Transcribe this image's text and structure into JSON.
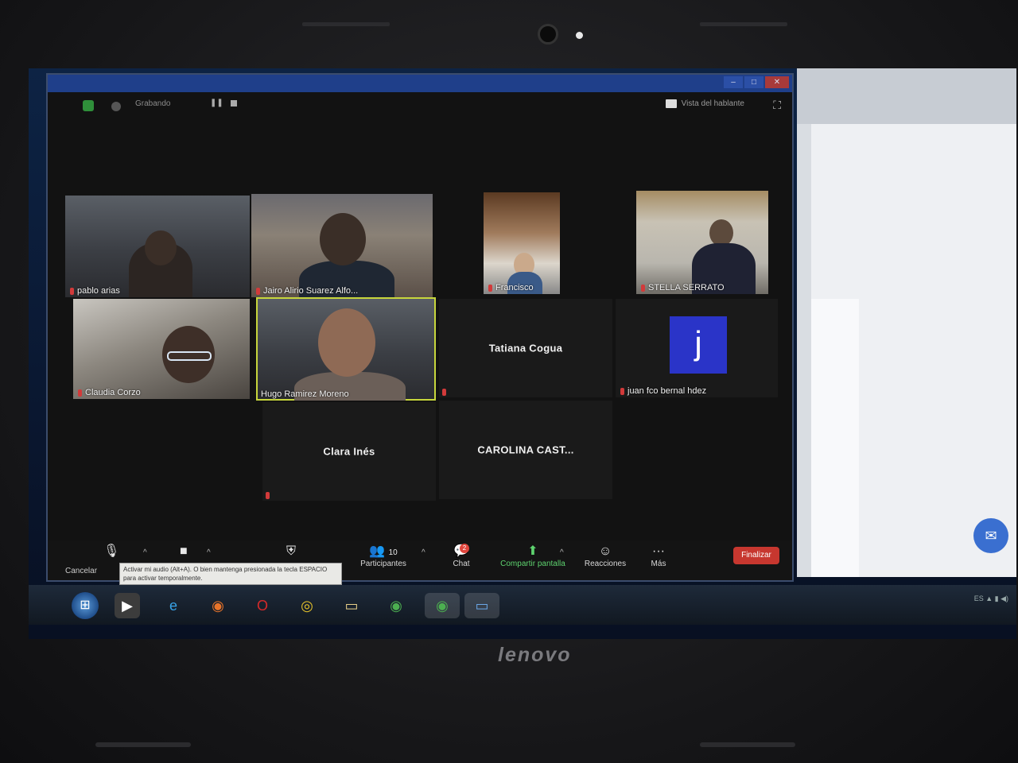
{
  "brand": {
    "laptop": "lenovo"
  },
  "zoom": {
    "top_bar": {
      "recording": "Grabando",
      "view_button": "Vista del hablante"
    },
    "participants": [
      {
        "id": "pablo",
        "name": "pablo arias",
        "muted": true,
        "video": true
      },
      {
        "id": "jairo",
        "name": "Jairo Alirio Suarez Alfo...",
        "muted": true,
        "video": true
      },
      {
        "id": "francisco",
        "name": "Francisco",
        "muted": true,
        "video": true
      },
      {
        "id": "stella",
        "name": "STELLA SERRATO",
        "muted": true,
        "video": true
      },
      {
        "id": "claudia",
        "name": "Claudia Corzo",
        "muted": true,
        "video": true
      },
      {
        "id": "hugo",
        "name": "Hugo Ramirez Moreno",
        "muted": false,
        "video": true,
        "active_speaker": true
      },
      {
        "id": "tatiana",
        "name": "Tatiana Cogua",
        "muted": true,
        "video": false
      },
      {
        "id": "juan",
        "name": "juan fco bernal hdez",
        "muted": true,
        "video": false,
        "avatar_letter": "j"
      },
      {
        "id": "clara",
        "name": "Clara Inés",
        "muted": true,
        "video": false
      },
      {
        "id": "carolina",
        "name": "CAROLINA CAST...",
        "muted": false,
        "video": false
      }
    ],
    "toolbar": {
      "cancel": "Cancelar",
      "participants_label": "Participantes",
      "participants_count": "10",
      "chat_label": "Chat",
      "chat_badge": "2",
      "share_label": "Compartir pantalla",
      "reactions_label": "Reacciones",
      "more_label": "Más",
      "end_label": "Finalizar"
    },
    "tooltip": "Activar mi audio (Alt+A). O bien mantenga presionada la tecla ESPACIO para activar temporalmente."
  },
  "colors": {
    "active_speaker": "#c7d63c",
    "share_green": "#5ed36f",
    "end_red": "#c7372f",
    "avatar_blue": "#2a34c8"
  }
}
